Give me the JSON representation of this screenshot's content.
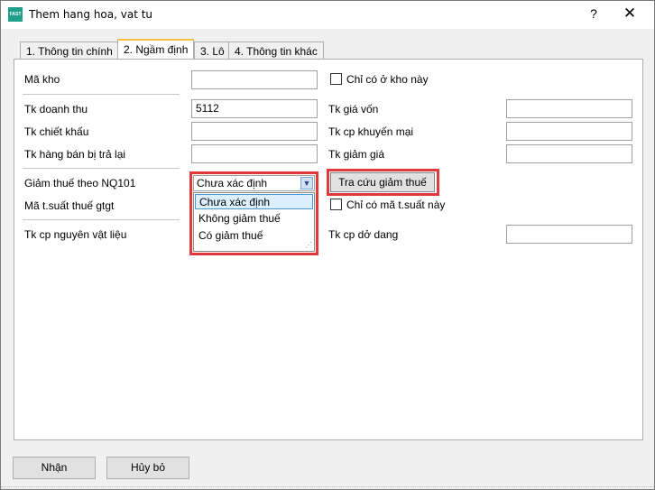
{
  "window": {
    "title": "Them hang hoa, vat tu",
    "app_icon_text": "FAST",
    "help_label": "?",
    "close_label": "✕"
  },
  "tabs": [
    {
      "label": "1. Thông tin chính"
    },
    {
      "label": "2. Ngầm định"
    },
    {
      "label": "3. Lô"
    },
    {
      "label": "4. Thông tin khác"
    }
  ],
  "form": {
    "ma_kho": {
      "label": "Mã kho",
      "value": ""
    },
    "chi_co_kho": {
      "label": "Chỉ có ở kho này",
      "checked": false
    },
    "tk_doanh_thu": {
      "label": "Tk doanh thu",
      "value": "5112"
    },
    "tk_gia_von": {
      "label": "Tk giá vốn",
      "value": ""
    },
    "tk_chiet_khau": {
      "label": "Tk chiết khấu",
      "value": ""
    },
    "tk_cp_khuyen_mai": {
      "label": "Tk cp khuyến mại",
      "value": ""
    },
    "tk_hang_ban_tra_lai": {
      "label": "Tk hàng bán bị trả lại",
      "value": ""
    },
    "tk_giam_gia": {
      "label": "Tk giảm giá",
      "value": ""
    },
    "giam_thue": {
      "label": "Giảm thuế theo NQ101",
      "selected": "Chưa xác định",
      "options": [
        "Chưa xác định",
        "Không giảm thuế",
        "Có giảm thuế"
      ]
    },
    "tra_cuu_button": "Tra cứu giảm thuế",
    "ma_tsuat": {
      "label": "Mã t.suất thuế gtgt",
      "value": ""
    },
    "chi_co_ma_tsuat": {
      "label": "Chỉ có mã t.suất này",
      "checked": false
    },
    "tk_cp_nvl": {
      "label": "Tk cp nguyên vật liệu",
      "value": ""
    },
    "tk_cp_do_dang": {
      "label": "Tk cp dở dang",
      "value": ""
    }
  },
  "footer": {
    "ok_label": "Nhận",
    "cancel_label": "Hủy bỏ"
  },
  "colors": {
    "highlight_border": "#e0383c",
    "active_tab_accent": "#f5c040",
    "selected_item_bg": "#dbeffd"
  }
}
